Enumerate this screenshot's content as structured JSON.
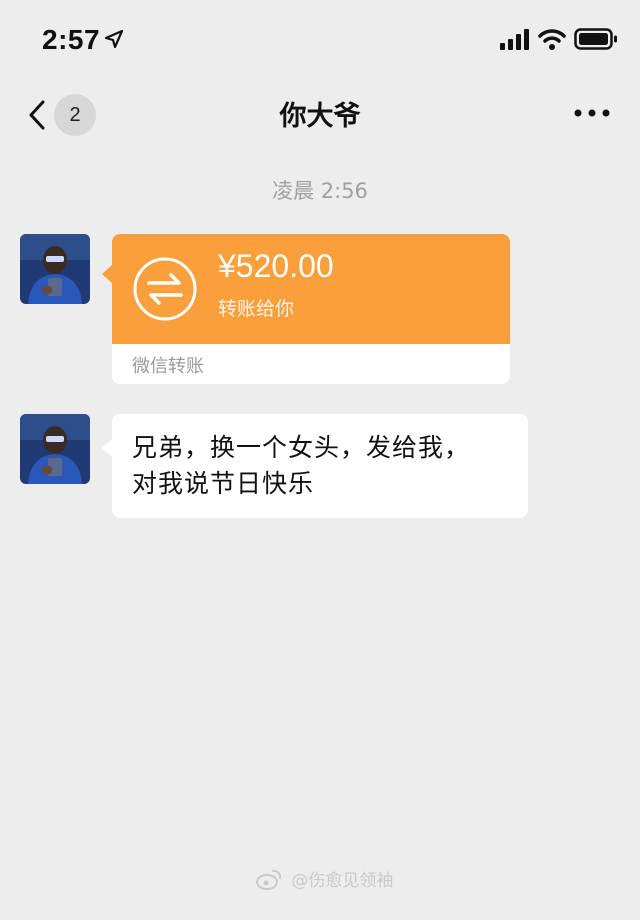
{
  "status_bar": {
    "time": "2:57",
    "icons": [
      "location-arrow-icon",
      "cellular-signal-icon",
      "wifi-icon",
      "battery-icon"
    ]
  },
  "nav": {
    "back_icon": "chevron-left-icon",
    "unread_count": "2",
    "title": "你大爷",
    "more_icon": "more-dots-icon"
  },
  "chat": {
    "timestamp": "凌晨 2:56",
    "messages": [
      {
        "type": "transfer",
        "amount": "¥520.00",
        "description": "转账给你",
        "footer": "微信转账",
        "icon": "transfer-arrows-icon",
        "color": "#f9a03d"
      },
      {
        "type": "text",
        "lines": [
          "兄弟，换一个女头，发给我，",
          "对我说节日快乐"
        ]
      }
    ]
  },
  "watermark": {
    "text": "@伤愈见领袖"
  }
}
